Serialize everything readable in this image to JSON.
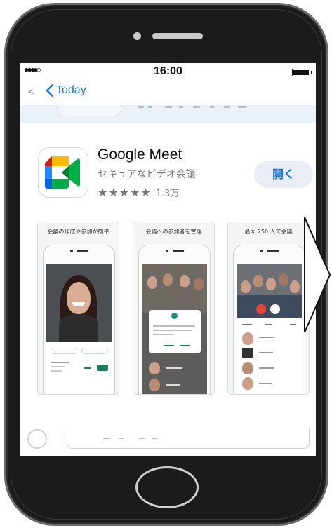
{
  "status_bar": {
    "signal": "●●●●○",
    "time": "16:00"
  },
  "nav": {
    "back_label": "Today"
  },
  "app": {
    "name": "Google Meet",
    "subtitle": "セキュアなビデオ会議",
    "stars": "★★★★★",
    "rating_count": "1.3万",
    "open_label": "開く"
  },
  "screenshots": [
    {
      "caption": "会議の作成や参加が簡単"
    },
    {
      "caption": "会議への参加者を管理"
    },
    {
      "caption": "最大 250 人で会議"
    }
  ],
  "colors": {
    "accent_blue": "#1a73d9",
    "meet_green": "#00832d",
    "meet_blue": "#2684fc",
    "meet_yellow": "#ffba00",
    "meet_red": "#ea4335"
  }
}
